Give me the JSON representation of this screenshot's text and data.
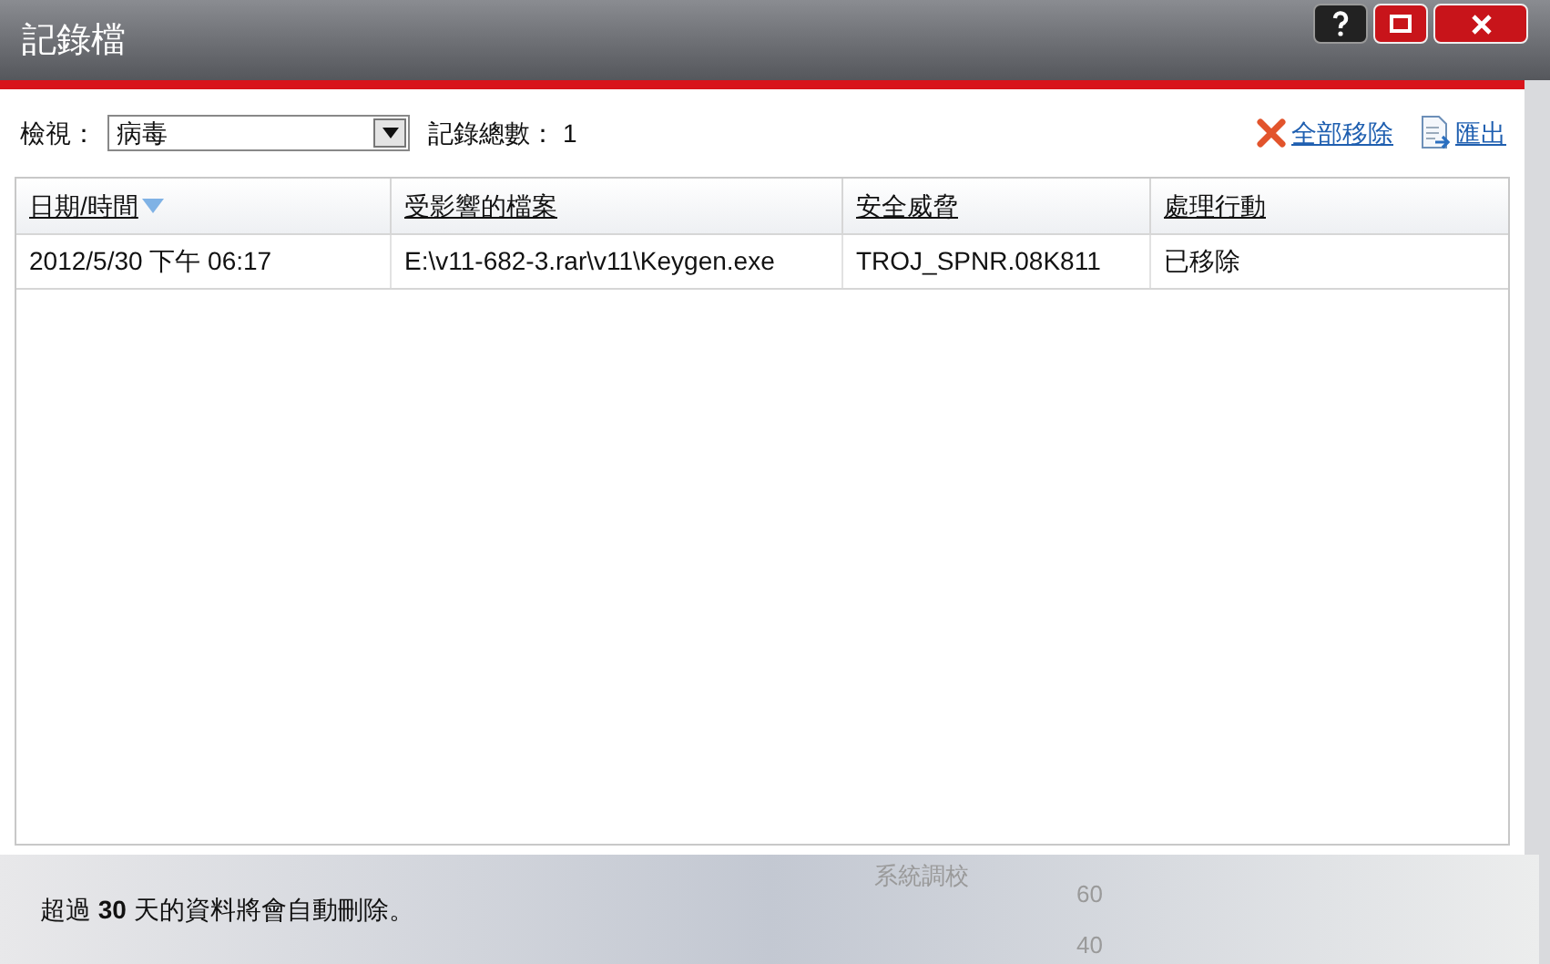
{
  "window": {
    "title": "記錄檔"
  },
  "toolbar": {
    "view_label": "檢視：",
    "view_value": "病毒",
    "count_label": "記錄總數：",
    "count_value": "1",
    "actions": [
      {
        "kind": "remove",
        "label": "全部移除"
      },
      {
        "kind": "export",
        "label": "匯出"
      }
    ]
  },
  "table": {
    "columns": [
      {
        "label": "日期/時間",
        "sorted": true
      },
      {
        "label": "受影響的檔案",
        "sorted": false
      },
      {
        "label": "安全威脅",
        "sorted": false
      },
      {
        "label": "處理行動",
        "sorted": false
      }
    ],
    "rows": [
      [
        "2012/5/30 下午 06:17",
        "E:\\v11-682-3.rar\\v11\\Keygen.exe",
        "TROJ_SPNR.08K811",
        "已移除"
      ]
    ]
  },
  "footer": {
    "note": "超過 **30** 天的資料將會自動刪除。",
    "background_texts": [
      "系統調校",
      "60",
      "40"
    ]
  }
}
